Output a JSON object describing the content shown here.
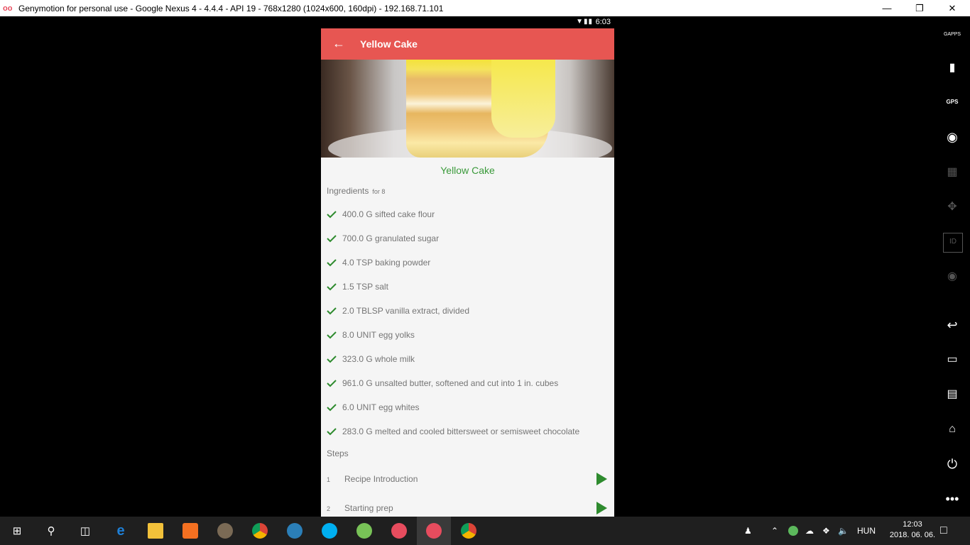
{
  "window": {
    "title": "Genymotion for personal use - Google Nexus 4 - 4.4.4 - API 19 - 768x1280 (1024x600, 160dpi) - 192.168.71.101",
    "logo": "oo"
  },
  "status_bar": {
    "time": "6:03",
    "icons": "wifi-signal-battery"
  },
  "app_bar": {
    "title": "Yellow Cake",
    "back_icon": "arrow-back-icon"
  },
  "recipe": {
    "name": "Yellow Cake",
    "ingredients_label": "Ingredients",
    "servings": "for 8",
    "ingredients": [
      "400.0 G sifted cake flour",
      "700.0 G granulated sugar",
      "4.0 TSP baking powder",
      "1.5 TSP salt",
      "2.0 TBLSP vanilla extract, divided",
      "8.0 UNIT egg yolks",
      "323.0 G whole milk",
      "961.0 G unsalted butter, softened and cut into 1 in. cubes",
      "6.0 UNIT egg whites",
      "283.0 G melted and cooled bittersweet or semisweet chocolate"
    ],
    "steps_label": "Steps",
    "steps": [
      {
        "num": "1",
        "label": "Recipe Introduction"
      },
      {
        "num": "2",
        "label": "Starting prep"
      }
    ],
    "accent_color": "#3a9a3a",
    "appbar_color": "#e75652"
  },
  "toolbar": {
    "items": [
      "gapps-icon",
      "battery-icon",
      "gps-icon",
      "webcam-icon",
      "capture-icon",
      "dpad-icon",
      "id-icon",
      "disk-icon",
      "back-icon",
      "recent-apps-icon",
      "menu-icon",
      "home-icon",
      "power-icon",
      "more-icon"
    ],
    "gapps_label": "GAPPS",
    "gps_label": "GPS",
    "id_label": "ID"
  },
  "taskbar": {
    "language": "HUN",
    "time": "12:03",
    "date": "2018. 06. 06."
  }
}
